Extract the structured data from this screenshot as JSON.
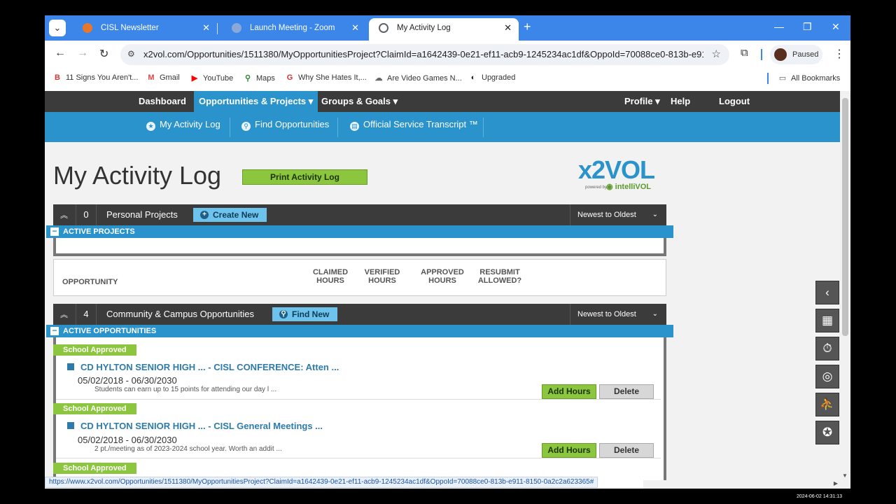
{
  "browser": {
    "tabs": [
      {
        "label": "CISL Newsletter",
        "icon": "newsletter-favicon",
        "color": "#e8772e"
      },
      {
        "label": "Launch Meeting - Zoom",
        "icon": "zoom-favicon",
        "color": "#8aa9d8"
      },
      {
        "label": "My Activity Log",
        "icon": "globe-favicon",
        "color": "#5f6368"
      }
    ],
    "url": "x2vol.com/Opportunities/1511380/MyOpportunitiesProject?ClaimId=a1642439-0e21-ef11-acb9-1245234ac1df&OppoId=70088ce0-813b-e91...",
    "profile_label": "Paused",
    "bookmarks": [
      {
        "label": "11 Signs You Aren't...",
        "icon": "B"
      },
      {
        "label": "Gmail",
        "icon": "M"
      },
      {
        "label": "YouTube",
        "icon": "▶"
      },
      {
        "label": "Maps",
        "icon": "⚲"
      },
      {
        "label": "Why She Hates It,...",
        "icon": "G"
      },
      {
        "label": "Are Video Games N...",
        "icon": "☁"
      },
      {
        "label": "Upgraded",
        "icon": "◐"
      }
    ],
    "all_bookmarks": "All Bookmarks",
    "status_url": "https://www.x2vol.com/Opportunities/1511380/MyOpportunitiesProject?ClaimId=a1642439-0e21-ef11-acb9-1245234ac1df&OppoId=70088ce0-813b-e911-8150-0a2c2a623365#"
  },
  "nav": {
    "dashboard": "Dashboard",
    "opportunities": "Opportunities & Projects",
    "groups": "Groups & Goals",
    "profile": "Profile",
    "help": "Help",
    "logout": "Logout"
  },
  "subnav": {
    "activity_log": "My Activity Log",
    "find": "Find Opportunities",
    "transcript": "Official Service Transcript ™"
  },
  "page": {
    "title": "My Activity Log",
    "print_label": "Print Activity Log",
    "logo_text": "x2VOL",
    "logo_powered": "powered by",
    "logo_intelli": "intelliVOL"
  },
  "personal": {
    "count": "0",
    "title": "Personal Projects",
    "button": "Create New",
    "sort": "Newest to Oldest",
    "active_label": "ACTIVE PROJECTS",
    "headers": {
      "opportunity": "OPPORTUNITY",
      "claimed": "CLAIMED HOURS",
      "verified": "VERIFIED HOURS",
      "approved": "APPROVED HOURS",
      "resubmit": "RESUBMIT ALLOWED?"
    }
  },
  "community": {
    "count": "4",
    "title": "Community & Campus Opportunities",
    "button": "Find New",
    "sort": "Newest to Oldest",
    "active_label": "ACTIVE OPPORTUNITIES",
    "items": [
      {
        "badge": "School Approved",
        "title": "CD HYLTON SENIOR HIGH ... - CISL CONFERENCE: Atten ...",
        "dates": "05/02/2018 - 06/30/2030",
        "desc": "Students can earn up to 15 points for attending our day l ...",
        "add": "Add Hours",
        "delete": "Delete"
      },
      {
        "badge": "School Approved",
        "title": "CD HYLTON SENIOR HIGH ... - CISL General Meetings ...",
        "dates": "05/02/2018 - 06/30/2030",
        "desc": "2 pt./meeting as of 2023-2024 school year. Worth an addit ...",
        "add": "Add Hours",
        "delete": "Delete"
      },
      {
        "badge": "School Approved"
      }
    ]
  },
  "clock": "2024-06-02 14:31:13"
}
